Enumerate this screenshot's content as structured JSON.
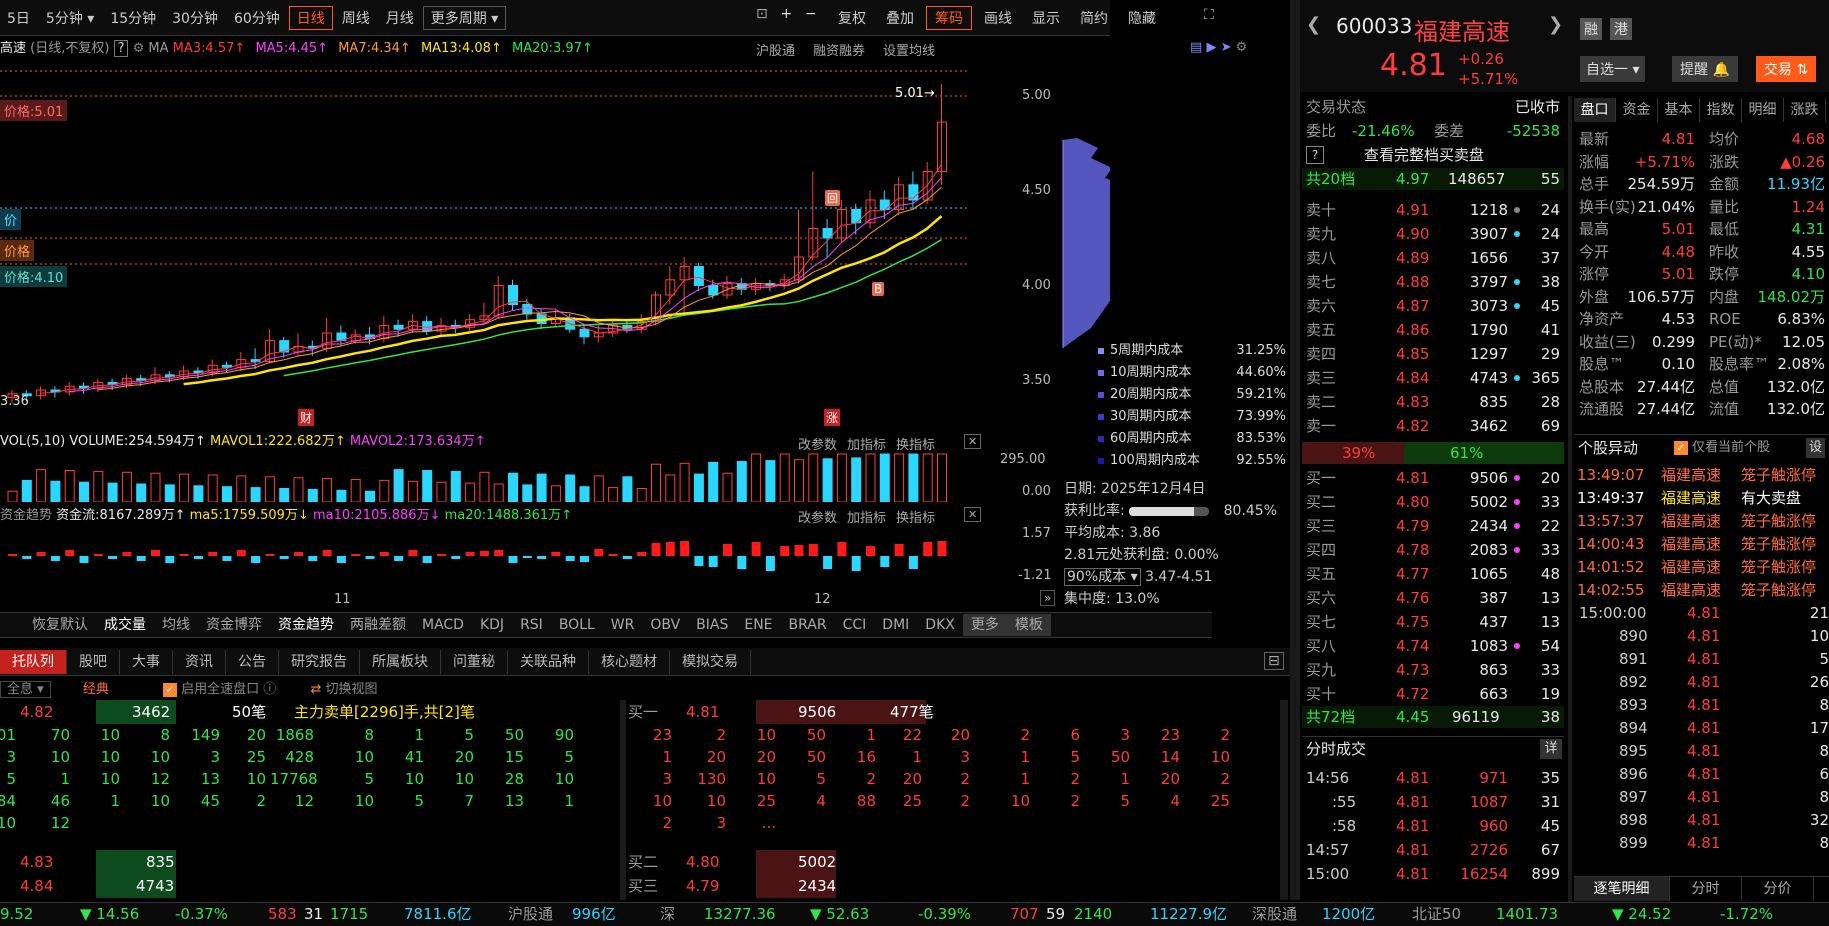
{
  "top_tabs": [
    "5日",
    "5分钟",
    "15分钟",
    "30分钟",
    "60分钟",
    "日线",
    "周线",
    "月线",
    "更多周期"
  ],
  "top_tools": [
    "复权",
    "叠加",
    "筹码",
    "画线",
    "显示",
    "简约",
    "隐藏"
  ],
  "chart_title": "高速",
  "chart_sub": "(日线,不复权)",
  "ma": {
    "label": "MA",
    "ma3": "MA3:4.57",
    "ma5": "MA5:4.45",
    "ma7": "MA7:4.34",
    "ma13": "MA13:4.08",
    "ma20": "MA20:3.97"
  },
  "chart_links": [
    "沪股通",
    "融资融券",
    "设置均线"
  ],
  "price_tags": {
    "high": "价格:5.01",
    "p1": "价",
    "p2": "价格",
    "low": "价格:4.10",
    "bottom": "3.36",
    "peak": "5.01"
  },
  "y_axis": [
    "5.00",
    "4.50",
    "4.00",
    "3.50"
  ],
  "markers": {
    "cai": "财",
    "zhang": "涨",
    "b": "B",
    "s": "回"
  },
  "vol": {
    "title": "VOL(5,10)",
    "volume": "VOLUME:254.594万",
    "mavol1": "MAVOL1:222.682万",
    "mavol2": "MAVOL2:173.634万",
    "axis_top": "295.00",
    "axis_bot": "0.00"
  },
  "fund": {
    "title": "资金趋势",
    "flow": "资金流:8167.289万",
    "ma5": "ma5:1759.509万",
    "ma10": "ma10:2105.886万",
    "ma20": "ma20:1488.361万",
    "axis_top": "1.57",
    "axis_bot": "-1.21"
  },
  "panel_links": [
    "改参数",
    "加指标",
    "换指标"
  ],
  "x_axis": [
    "11",
    "12"
  ],
  "indicator_tabs": [
    "恢复默认",
    "成交量",
    "均线",
    "资金博弈",
    "资金趋势",
    "两融差额",
    "MACD",
    "KDJ",
    "RSI",
    "BOLL",
    "WR",
    "OBV",
    "BIAS",
    "ENE",
    "BRAR",
    "CCI",
    "DMI",
    "DKX",
    "更多",
    "模板"
  ],
  "chip": {
    "date": "日期: 2025年12月4日",
    "profit_label": "获利比率:",
    "profit": "80.45%",
    "avg_label": "平均成本:",
    "avg": "3.86",
    "p281": "2.81元处获利盘:",
    "p281v": "0.00%",
    "cost90": "90%成本",
    "cost90v": "3.47-4.51",
    "conc_label": "集中度:",
    "conc": "13.0%",
    "legend": [
      {
        "k": "5周期内成本",
        "v": "31.25%"
      },
      {
        "k": "10周期内成本",
        "v": "44.60%"
      },
      {
        "k": "20周期内成本",
        "v": "59.21%"
      },
      {
        "k": "30周期内成本",
        "v": "73.99%"
      },
      {
        "k": "60周期内成本",
        "v": "83.53%"
      },
      {
        "k": "100周期内成本",
        "v": "92.55%"
      }
    ]
  },
  "bottom_tabs": [
    "托队列",
    "股吧",
    "大事",
    "资讯",
    "公告",
    "研究报告",
    "所属板块",
    "问董秘",
    "关联品种",
    "核心题材",
    "模拟交易"
  ],
  "queue": {
    "all": "全息",
    "classic": "经典",
    "quick": "启用全速盘口",
    "switch": "切换视图",
    "sell_info": "主力卖单[2296]手,共[2]笔",
    "sell_price": "4.82",
    "sell_vol": "3462",
    "sell_cnt": "50笔",
    "buy1": "买一",
    "buy1_price": "4.81",
    "buy1_vol": "9506",
    "buy1_cnt": "477笔",
    "left_rows": [
      [
        "01",
        "70",
        "10",
        "8",
        "149",
        "20",
        "1868",
        "8",
        "1",
        "5",
        "50",
        "90"
      ],
      [
        "3",
        "10",
        "10",
        "10",
        "3",
        "25",
        "428",
        "10",
        "41",
        "20",
        "15",
        "5"
      ],
      [
        "5",
        "1",
        "10",
        "12",
        "13",
        "10",
        "17768",
        "5",
        "10",
        "10",
        "28",
        "10"
      ],
      [
        "84",
        "46",
        "1",
        "10",
        "45",
        "2",
        "12",
        "10",
        "5",
        "7",
        "13",
        "1"
      ],
      [
        "10",
        "12"
      ]
    ],
    "right_rows": [
      [
        "23",
        "2",
        "10",
        "50",
        "1",
        "22",
        "20",
        "2",
        "6",
        "3",
        "23",
        "2"
      ],
      [
        "1",
        "20",
        "20",
        "50",
        "16",
        "1",
        "3",
        "1",
        "5",
        "50",
        "14",
        "10"
      ],
      [
        "3",
        "130",
        "10",
        "5",
        "2",
        "20",
        "2",
        "1",
        "2",
        "1",
        "20",
        "2"
      ],
      [
        "10",
        "10",
        "25",
        "4",
        "88",
        "25",
        "2",
        "10",
        "2",
        "5",
        "4",
        "25"
      ],
      [
        "2",
        "3",
        "..."
      ]
    ],
    "s2": {
      "p": "4.83",
      "v": "835"
    },
    "s3": {
      "p": "4.84",
      "v": "4743"
    },
    "b2": {
      "l": "买二",
      "p": "4.80",
      "v": "5002"
    },
    "b3": {
      "l": "买三",
      "p": "4.79",
      "v": "2434"
    }
  },
  "ticker": {
    "a": "9.52",
    "b": "▼ 14.56",
    "c": "-0.37%",
    "d": "583",
    "e": "31",
    "f": "1715",
    "g": "7811.6亿",
    "hgt": "沪股通",
    "hgtv": "996亿",
    "shen": "深",
    "sv": "13277.36",
    "sc": "▼ 52.63",
    "sp": "-0.39%",
    "s1": "707",
    "s2": "59",
    "s3": "2140",
    "s4": "11227.9亿",
    "sgt": "深股通",
    "sgtv": "1200亿",
    "bz": "北证50",
    "bzv": "1401.73",
    "bzc": "▼ 24.52",
    "bzp": "-1.72%"
  },
  "stock": {
    "code": "600033",
    "name": "福建高速",
    "price": "4.81",
    "chg": "+0.26",
    "pct": "+5.71%",
    "rong": "融",
    "gang": "港",
    "zixuan": "自选一",
    "remind": "提醒",
    "trade": "交易"
  },
  "status": {
    "label": "交易状态",
    "value": "已收市",
    "weibi": "委比",
    "weibiv": "-21.46%",
    "weicha": "委差",
    "weichav": "-52538",
    "full": "查看完整档买卖盘",
    "total20": "共20档",
    "total20p": "4.97",
    "total20v": "148657",
    "total20c": "55",
    "ratio_l": "39%",
    "ratio_r": "61%",
    "total72": "共72档",
    "total72p": "4.45",
    "total72v": "96119",
    "total72c": "38"
  },
  "sells": [
    [
      "卖十",
      "4.91",
      "1218",
      "24"
    ],
    [
      "卖九",
      "4.90",
      "3907",
      "24"
    ],
    [
      "卖八",
      "4.89",
      "1656",
      "37"
    ],
    [
      "卖七",
      "4.88",
      "3797",
      "38"
    ],
    [
      "卖六",
      "4.87",
      "3073",
      "45"
    ],
    [
      "卖五",
      "4.86",
      "1790",
      "41"
    ],
    [
      "卖四",
      "4.85",
      "1297",
      "29"
    ],
    [
      "卖三",
      "4.84",
      "4743",
      "365"
    ],
    [
      "卖二",
      "4.83",
      "835",
      "28"
    ],
    [
      "卖一",
      "4.82",
      "3462",
      "69"
    ]
  ],
  "buys": [
    [
      "买一",
      "4.81",
      "9506",
      "20"
    ],
    [
      "买二",
      "4.80",
      "5002",
      "33"
    ],
    [
      "买三",
      "4.79",
      "2434",
      "22"
    ],
    [
      "买四",
      "4.78",
      "2083",
      "33"
    ],
    [
      "买五",
      "4.77",
      "1065",
      "48"
    ],
    [
      "买六",
      "4.76",
      "387",
      "13"
    ],
    [
      "买七",
      "4.75",
      "437",
      "13"
    ],
    [
      "买八",
      "4.74",
      "1083",
      "54"
    ],
    [
      "买九",
      "4.73",
      "863",
      "33"
    ],
    [
      "买十",
      "4.72",
      "663",
      "19"
    ]
  ],
  "ticks": {
    "title": "分时成交",
    "detail": "详",
    "rows": [
      [
        "14:56",
        "4.81",
        "971",
        "35"
      ],
      [
        ":55",
        "4.81",
        "1087",
        "31"
      ],
      [
        ":58",
        "4.81",
        "960",
        "45"
      ],
      [
        "14:57",
        "4.81",
        "2726",
        "67"
      ],
      [
        "15:00",
        "4.81",
        "16254",
        "899"
      ]
    ]
  },
  "right_tabs": [
    "盘口",
    "资金",
    "基本",
    "指数",
    "明细",
    "涨跌"
  ],
  "quote": [
    [
      "最新",
      "4.81",
      "均价",
      "4.68"
    ],
    [
      "涨幅",
      "+5.71%",
      "涨跌",
      "▲0.26"
    ],
    [
      "总手",
      "254.59万",
      "金额",
      "11.93亿"
    ],
    [
      "换手(实)",
      "21.04%",
      "量比",
      "1.24"
    ],
    [
      "最高",
      "5.01",
      "最低",
      "4.31"
    ],
    [
      "今开",
      "4.48",
      "昨收",
      "4.55"
    ],
    [
      "涨停",
      "5.01",
      "跌停",
      "4.10"
    ],
    [
      "外盘",
      "106.57万",
      "内盘",
      "148.02万"
    ],
    [
      "净资产",
      "4.53",
      "ROE",
      "6.83%"
    ],
    [
      "收益(三)",
      "0.299",
      "PE(动)*",
      "12.05"
    ],
    [
      "股息™",
      "0.10",
      "股息率™",
      "2.08%"
    ],
    [
      "总股本",
      "27.44亿",
      "总值",
      "132.0亿"
    ],
    [
      "流通股",
      "27.44亿",
      "流值",
      "132.0亿"
    ]
  ],
  "alerts": {
    "title": "个股异动",
    "only": "仅看当前个股",
    "set": "设",
    "rows": [
      [
        "13:49:07",
        "福建高速",
        "笼子触涨停"
      ],
      [
        "13:49:37",
        "福建高速",
        "有大卖盘"
      ],
      [
        "13:57:37",
        "福建高速",
        "笼子触涨停"
      ],
      [
        "14:00:43",
        "福建高速",
        "笼子触涨停"
      ],
      [
        "14:01:52",
        "福建高速",
        "笼子触涨停"
      ],
      [
        "14:02:55",
        "福建高速",
        "笼子触涨停"
      ]
    ]
  },
  "trades": {
    "rows": [
      [
        "15:00:00",
        "4.81",
        "21"
      ],
      [
        "890",
        "4.81",
        "10"
      ],
      [
        "891",
        "4.81",
        "5"
      ],
      [
        "892",
        "4.81",
        "26"
      ],
      [
        "893",
        "4.81",
        "8"
      ],
      [
        "894",
        "4.81",
        "17"
      ],
      [
        "895",
        "4.81",
        "8"
      ],
      [
        "896",
        "4.81",
        "6"
      ],
      [
        "897",
        "4.81",
        "8"
      ],
      [
        "898",
        "4.81",
        "32"
      ],
      [
        "899",
        "4.81",
        "8"
      ]
    ],
    "tabs": [
      "逐笔明细",
      "分时",
      "分价"
    ]
  },
  "colors": {
    "up": "#ff3b3b",
    "down": "#2ee64a",
    "accent": "#ff7b00",
    "cyan": "#2bd6ff"
  }
}
